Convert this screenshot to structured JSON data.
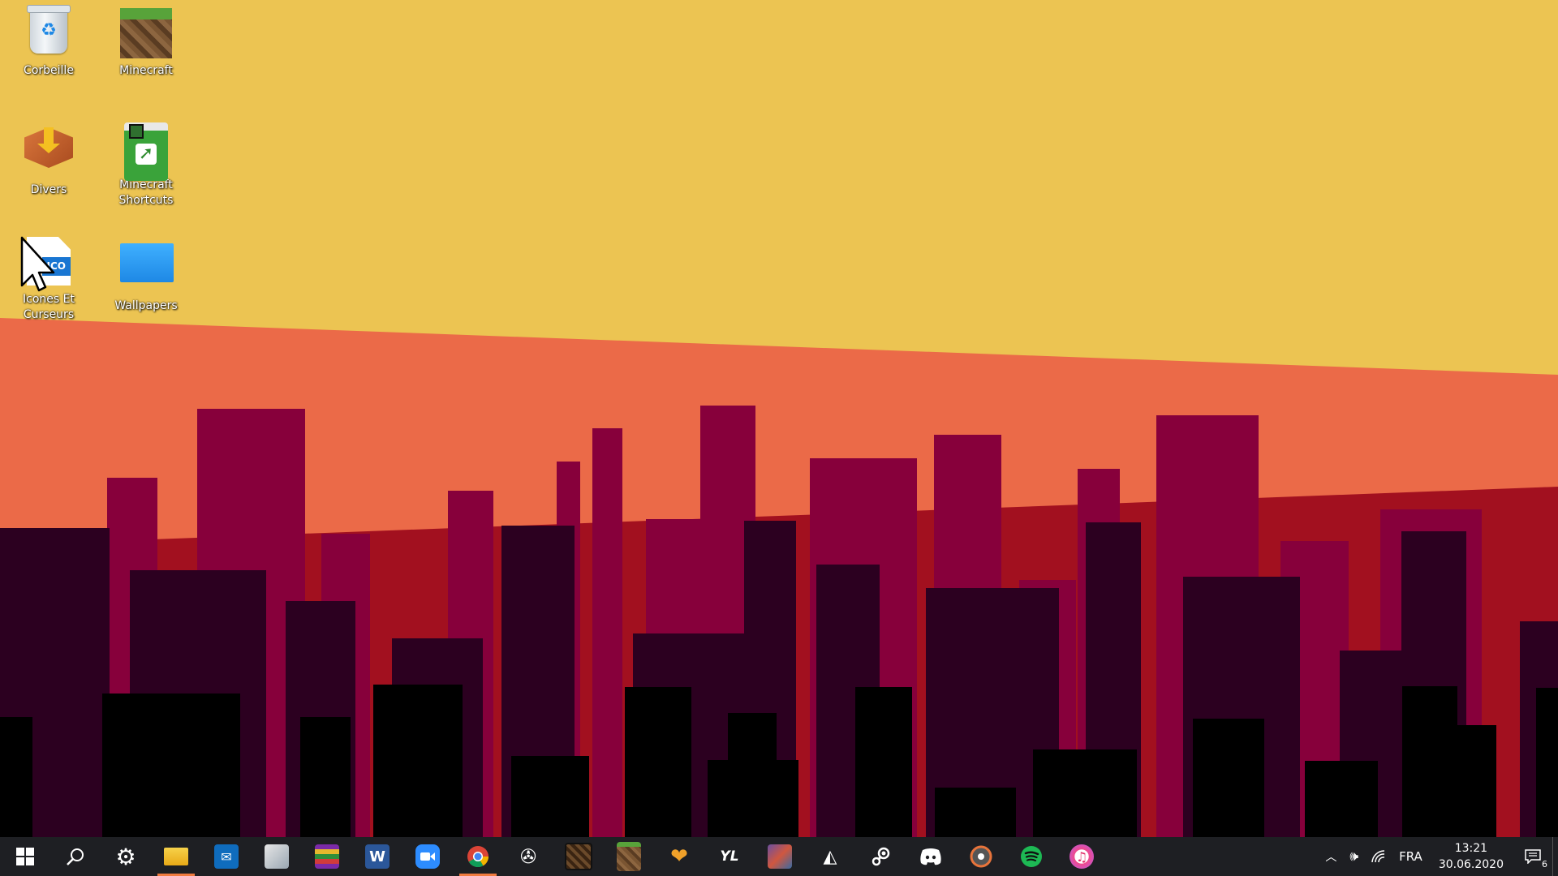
{
  "desktop": {
    "icons": [
      {
        "label": "Corbeille",
        "icon": "recycle-bin-icon"
      },
      {
        "label": "Minecraft",
        "icon": "minecraft-grass-block-icon"
      },
      {
        "label": "Divers",
        "icon": "package-box-icon"
      },
      {
        "label": "Minecraft Shortcuts",
        "icon": "shortcut-folder-icon"
      },
      {
        "label": "Icones Et Curseurs",
        "icon": "ico-file-icon"
      },
      {
        "label": "Wallpapers",
        "icon": "blue-folder-icon"
      }
    ],
    "wallpaper_colors": {
      "sky": "#ecc452",
      "sunset": "#eb6a48",
      "haze": "#a2101f",
      "buildings_far": "#87003b",
      "buildings_mid": "#2c0020",
      "buildings_near": "#000000"
    }
  },
  "taskbar": {
    "apps": [
      {
        "name": "start",
        "icon": "windows-logo-icon"
      },
      {
        "name": "search",
        "icon": "search-icon"
      },
      {
        "name": "settings",
        "icon": "gear-icon"
      },
      {
        "name": "file-explorer",
        "icon": "folder-icon",
        "active": true
      },
      {
        "name": "mail",
        "icon": "mail-icon"
      },
      {
        "name": "photos",
        "icon": "photo-viewer-icon"
      },
      {
        "name": "winrar",
        "icon": "winrar-icon"
      },
      {
        "name": "word",
        "icon": "word-icon",
        "glyph": "W"
      },
      {
        "name": "zoom",
        "icon": "zoom-camera-icon"
      },
      {
        "name": "chrome",
        "icon": "chrome-icon",
        "active": true
      },
      {
        "name": "app-triskelion",
        "icon": "triskelion-icon"
      },
      {
        "name": "minecraft-dungeons",
        "icon": "dark-block-icon"
      },
      {
        "name": "minecraft",
        "icon": "grass-block-icon"
      },
      {
        "name": "app-heart",
        "icon": "half-heart-icon"
      },
      {
        "name": "ylands",
        "icon": "yl-logo-icon",
        "glyph": "YL"
      },
      {
        "name": "game-art",
        "icon": "game-art-icon"
      },
      {
        "name": "unity",
        "icon": "unity-icon"
      },
      {
        "name": "steam",
        "icon": "steam-icon"
      },
      {
        "name": "discord",
        "icon": "discord-icon"
      },
      {
        "name": "groove",
        "icon": "music-disc-icon"
      },
      {
        "name": "spotify",
        "icon": "spotify-icon"
      },
      {
        "name": "itunes",
        "icon": "itunes-icon"
      }
    ],
    "tray": {
      "language": "FRA",
      "time": "13:21",
      "date": "30.06.2020",
      "notifications": "6"
    }
  }
}
